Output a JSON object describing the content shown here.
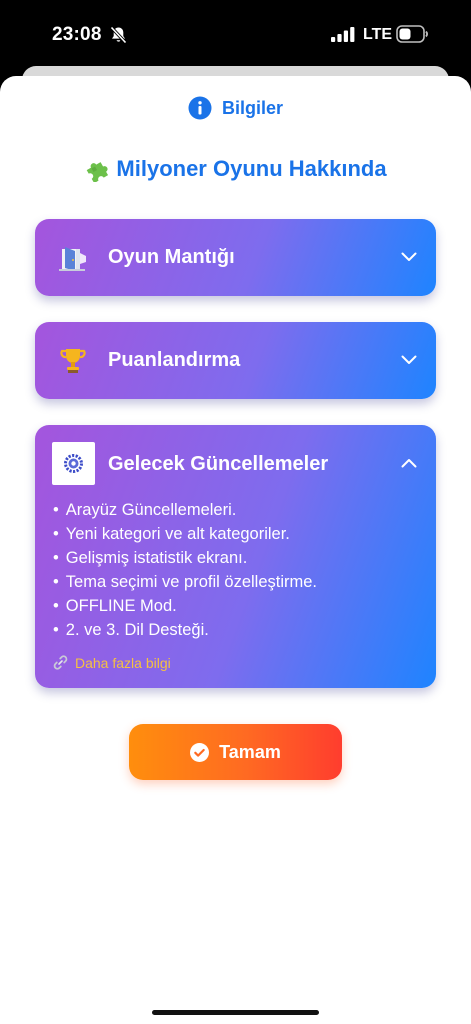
{
  "status_bar": {
    "time": "23:08",
    "network": "LTE",
    "icons": [
      "bell-slash-icon",
      "signal-icon",
      "battery-icon"
    ]
  },
  "header": {
    "icon": "info-icon",
    "title": "Bilgiler",
    "accent_color": "#1a73e8"
  },
  "page_title": {
    "icon": "puzzle-icon",
    "text": "Milyoner Oyunu Hakkında"
  },
  "sections": [
    {
      "title": "Oyun Mantığı",
      "icon": "door-icon",
      "expanded": false
    },
    {
      "title": "Puanlandırma",
      "icon": "trophy-icon",
      "expanded": false
    },
    {
      "title": "Gelecek Güncellemeler",
      "icon": "gear-icon",
      "expanded": true,
      "items": [
        "Arayüz Güncellemeleri.",
        "Yeni kategori ve alt kategoriler.",
        "Gelişmiş istatistik ekranı.",
        "Tema seçimi ve profil özelleştirme.",
        "OFFLINE Mod.",
        "2. ve 3. Dil Desteği."
      ],
      "link_label": "Daha fazla bilgi",
      "link_color": "#f5c142"
    }
  ],
  "ok_button": {
    "label": "Tamam",
    "icon": "check-circle-icon"
  },
  "colors": {
    "card_gradient_start": "#a455dd",
    "card_gradient_end": "#1e84ff",
    "button_gradient_start": "#ff8e0d",
    "button_gradient_end": "#ff3d2e"
  }
}
